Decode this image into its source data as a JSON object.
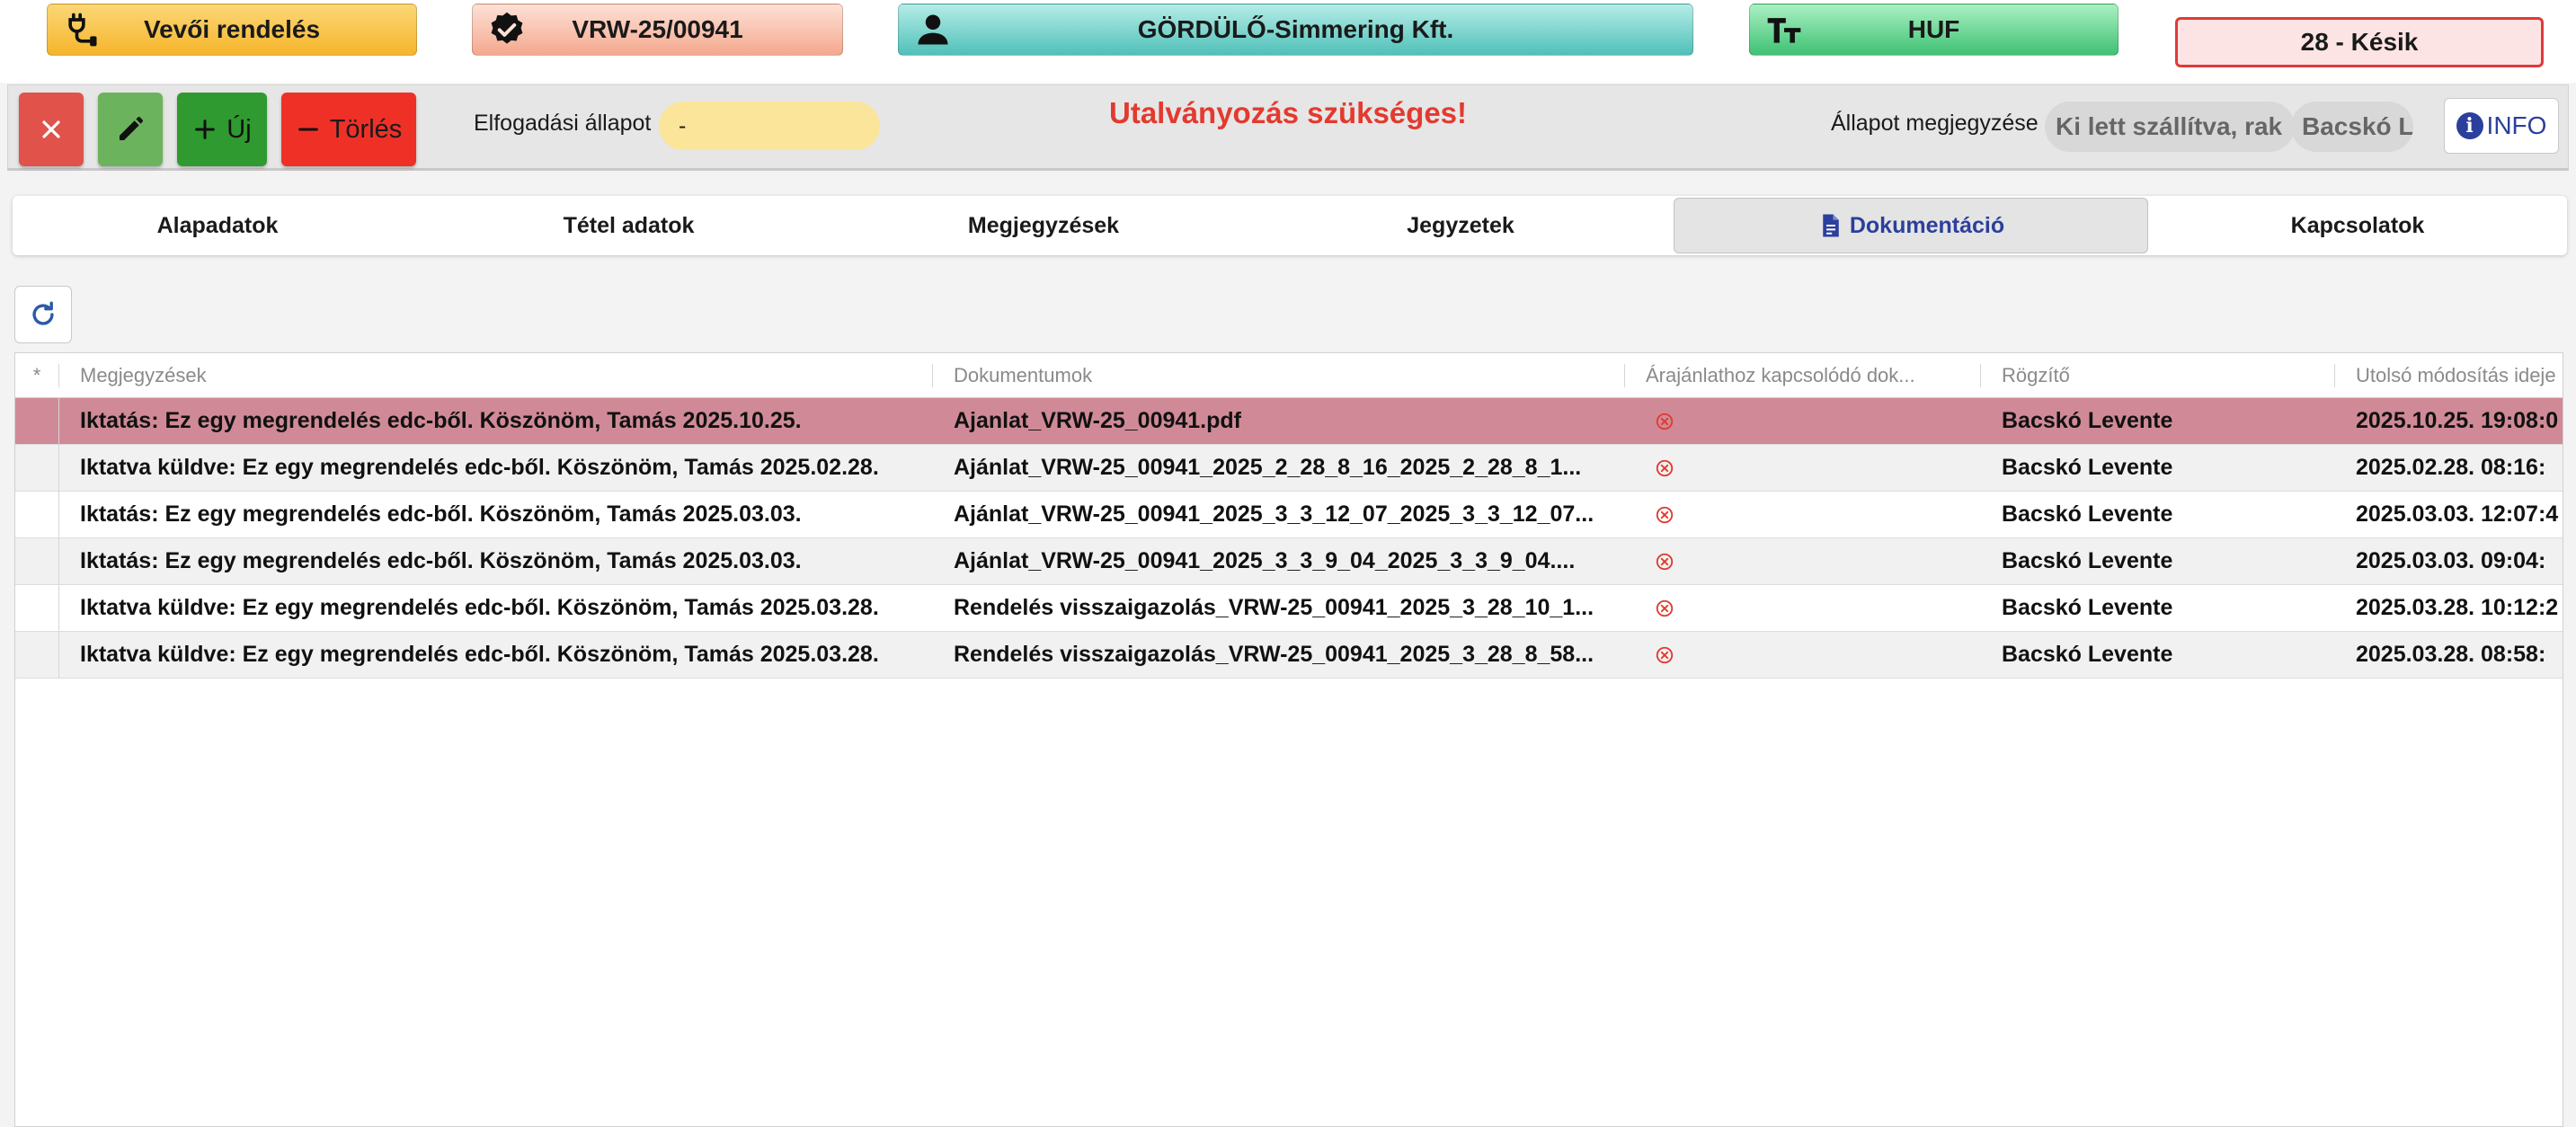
{
  "header": {
    "order_type": "Vevői rendelés",
    "order_code": "VRW-25/00941",
    "partner": "GÖRDÜLŐ-Simmering Kft.",
    "currency": "HUF",
    "status": "28 - Késik"
  },
  "toolbar": {
    "new_label": "Új",
    "delete_label": "Törlés",
    "acceptance_label": "Elfogadási állapot",
    "acceptance_value": "-",
    "warning": "Utalványozás szükséges!",
    "status_note_label": "Állapot megjegyzése",
    "status_note_text": "Ki lett szállítva, rak",
    "status_note_user": "Bacskó L",
    "info_label": "INFO"
  },
  "tabs": [
    {
      "label": "Alapadatok"
    },
    {
      "label": "Tétel adatok"
    },
    {
      "label": "Megjegyzések"
    },
    {
      "label": "Jegyzetek"
    },
    {
      "label": "Dokumentáció",
      "active": true
    },
    {
      "label": "Kapcsolatok"
    }
  ],
  "grid": {
    "columns": {
      "star": "*",
      "notes": "Megjegyzések",
      "documents": "Dokumentumok",
      "quote_docs": "Árajánlathoz kapcsolódó dok...",
      "recorder": "Rögzítő",
      "modified": "Utolsó módosítás ideje"
    },
    "rows": [
      {
        "notes": "Iktatás: Ez egy megrendelés edc-ből. Köszönöm, Tamás 2025.10.25.",
        "document": "Ajanlat_VRW-25_00941.pdf",
        "quote_linked": false,
        "recorder": "Bacskó Levente",
        "modified": "2025.10.25. 19:08:0",
        "selected": true
      },
      {
        "notes": "Iktatva küldve: Ez egy megrendelés edc-ből. Köszönöm, Tamás 2025.02.28.",
        "document": "Ajánlat_VRW-25_00941_2025_2_28_8_16_2025_2_28_8_1...",
        "quote_linked": false,
        "recorder": "Bacskó Levente",
        "modified": "2025.02.28. 08:16:"
      },
      {
        "notes": "Iktatás: Ez egy megrendelés edc-ből. Köszönöm, Tamás 2025.03.03.",
        "document": "Ajánlat_VRW-25_00941_2025_3_3_12_07_2025_3_3_12_07...",
        "quote_linked": false,
        "recorder": "Bacskó Levente",
        "modified": "2025.03.03. 12:07:4"
      },
      {
        "notes": "Iktatás: Ez egy megrendelés edc-ből. Köszönöm, Tamás 2025.03.03.",
        "document": "Ajánlat_VRW-25_00941_2025_3_3_9_04_2025_3_3_9_04....",
        "quote_linked": false,
        "recorder": "Bacskó Levente",
        "modified": "2025.03.03. 09:04:"
      },
      {
        "notes": "Iktatva küldve: Ez egy megrendelés edc-ből. Köszönöm, Tamás 2025.03.28.",
        "document": "Rendelés visszaigazolás_VRW-25_00941_2025_3_28_10_1...",
        "quote_linked": false,
        "recorder": "Bacskó Levente",
        "modified": "2025.03.28. 10:12:2"
      },
      {
        "notes": "Iktatva küldve: Ez egy megrendelés edc-ből. Köszönöm, Tamás 2025.03.28.",
        "document": "Rendelés visszaigazolás_VRW-25_00941_2025_3_28_8_58...",
        "quote_linked": false,
        "recorder": "Bacskó Levente",
        "modified": "2025.03.28. 08:58:"
      }
    ]
  },
  "colors": {
    "order_badge": "#f6b52b",
    "code_badge": "#f5a88e",
    "partner_badge": "#4fc1b9",
    "currency_badge": "#3fc174",
    "status_border": "#e03a3a",
    "warning_text": "#e33a2f",
    "selected_row": "#d08a97",
    "active_tab_text": "#2b3f9c"
  },
  "icons": {
    "order_badge": "plug-icon",
    "code_badge": "verified-badge-icon",
    "partner_badge": "person-icon",
    "currency_badge": "text-size-icon",
    "close": "close-icon",
    "edit": "pencil-icon",
    "new": "plus-icon",
    "delete": "minus-icon",
    "info": "info-circle-icon",
    "active_tab": "document-icon",
    "refresh": "refresh-icon",
    "quote_linked": "x-circle-icon"
  }
}
